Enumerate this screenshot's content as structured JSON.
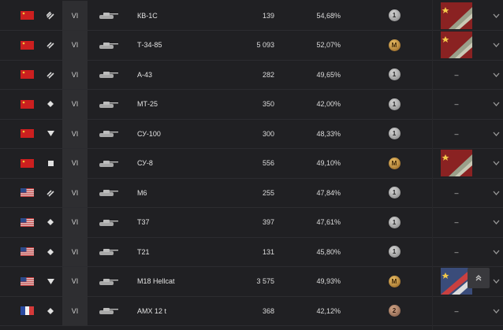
{
  "vehicles": [
    {
      "nation": "ussr",
      "class": "heavy",
      "tier": "VI",
      "name": "КВ-1С",
      "battles": "139",
      "winrate": "54,68%",
      "mastery": "1",
      "mastery_level": "silver",
      "marks": "tile",
      "marks_nation": "ussr"
    },
    {
      "nation": "ussr",
      "class": "medium",
      "tier": "VI",
      "name": "Т-34-85",
      "battles": "5 093",
      "winrate": "52,07%",
      "mastery": "M",
      "mastery_level": "gold",
      "marks": "tile",
      "marks_nation": "ussr"
    },
    {
      "nation": "ussr",
      "class": "medium",
      "tier": "VI",
      "name": "А-43",
      "battles": "282",
      "winrate": "49,65%",
      "mastery": "1",
      "mastery_level": "silver",
      "marks": "–"
    },
    {
      "nation": "ussr",
      "class": "light",
      "tier": "VI",
      "name": "МТ-25",
      "battles": "350",
      "winrate": "42,00%",
      "mastery": "1",
      "mastery_level": "silver",
      "marks": "–"
    },
    {
      "nation": "ussr",
      "class": "td",
      "tier": "VI",
      "name": "СУ-100",
      "battles": "300",
      "winrate": "48,33%",
      "mastery": "1",
      "mastery_level": "silver",
      "marks": "–"
    },
    {
      "nation": "ussr",
      "class": "spg",
      "tier": "VI",
      "name": "СУ-8",
      "battles": "556",
      "winrate": "49,10%",
      "mastery": "M",
      "mastery_level": "gold",
      "marks": "tile",
      "marks_nation": "ussr"
    },
    {
      "nation": "usa",
      "class": "medium",
      "tier": "VI",
      "name": "M6",
      "battles": "255",
      "winrate": "47,84%",
      "mastery": "1",
      "mastery_level": "silver",
      "marks": "–"
    },
    {
      "nation": "usa",
      "class": "light",
      "tier": "VI",
      "name": "T37",
      "battles": "397",
      "winrate": "47,61%",
      "mastery": "1",
      "mastery_level": "silver",
      "marks": "–"
    },
    {
      "nation": "usa",
      "class": "light",
      "tier": "VI",
      "name": "T21",
      "battles": "131",
      "winrate": "45,80%",
      "mastery": "1",
      "mastery_level": "silver",
      "marks": "–"
    },
    {
      "nation": "usa",
      "class": "td",
      "tier": "VI",
      "name": "M18 Hellcat",
      "battles": "3 575",
      "winrate": "49,93%",
      "mastery": "M",
      "mastery_level": "gold",
      "marks": "tile",
      "marks_nation": "usa"
    },
    {
      "nation": "france",
      "class": "light",
      "tier": "VI",
      "name": "AMX 12 t",
      "battles": "368",
      "winrate": "42,12%",
      "mastery": "2",
      "mastery_level": "bronze",
      "marks": "–"
    }
  ],
  "scroll_top_icon": "double-chevron-up-icon",
  "row_expand_icon": "chevron-down-icon"
}
